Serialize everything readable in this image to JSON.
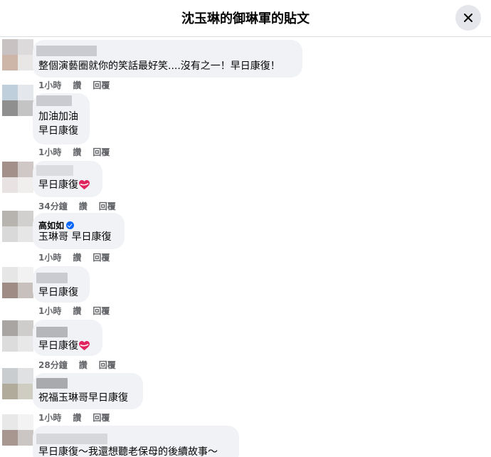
{
  "header": {
    "title": "沈玉琳的御琳軍的貼文",
    "close_icon": "close-icon"
  },
  "actions": {
    "like": "讚",
    "reply": "回覆"
  },
  "comments": [
    {
      "name": "",
      "text": "整個演藝圈就你的笑話最好笑....沒有之一！早日康復！",
      "time": "1小時",
      "heart": false
    },
    {
      "name": "",
      "text": "加油加油\n早日康復",
      "time": "1小時",
      "heart": false
    },
    {
      "name": "",
      "text": "早日康復",
      "time": "34分鐘",
      "heart": true
    },
    {
      "name": "高如如",
      "verified": true,
      "text": "玉琳哥 早日康復",
      "time": "1小時",
      "heart": false
    },
    {
      "name": "",
      "text": "早日康復",
      "time": "1小時",
      "heart": false
    },
    {
      "name": "",
      "text": "早日康復",
      "time": "28分鐘",
      "heart": true
    },
    {
      "name": "",
      "text": "祝福玉琳哥早日康復",
      "time": "1小時",
      "heart": false
    },
    {
      "name": "",
      "text": "早日康復～我還想聽老保母的後續故事～",
      "time": "",
      "heart": false
    }
  ],
  "colors": {
    "bubble": "#f0f2f5",
    "meta": "#65676b",
    "verified": "#0866ff",
    "heart": "#e0245e"
  }
}
